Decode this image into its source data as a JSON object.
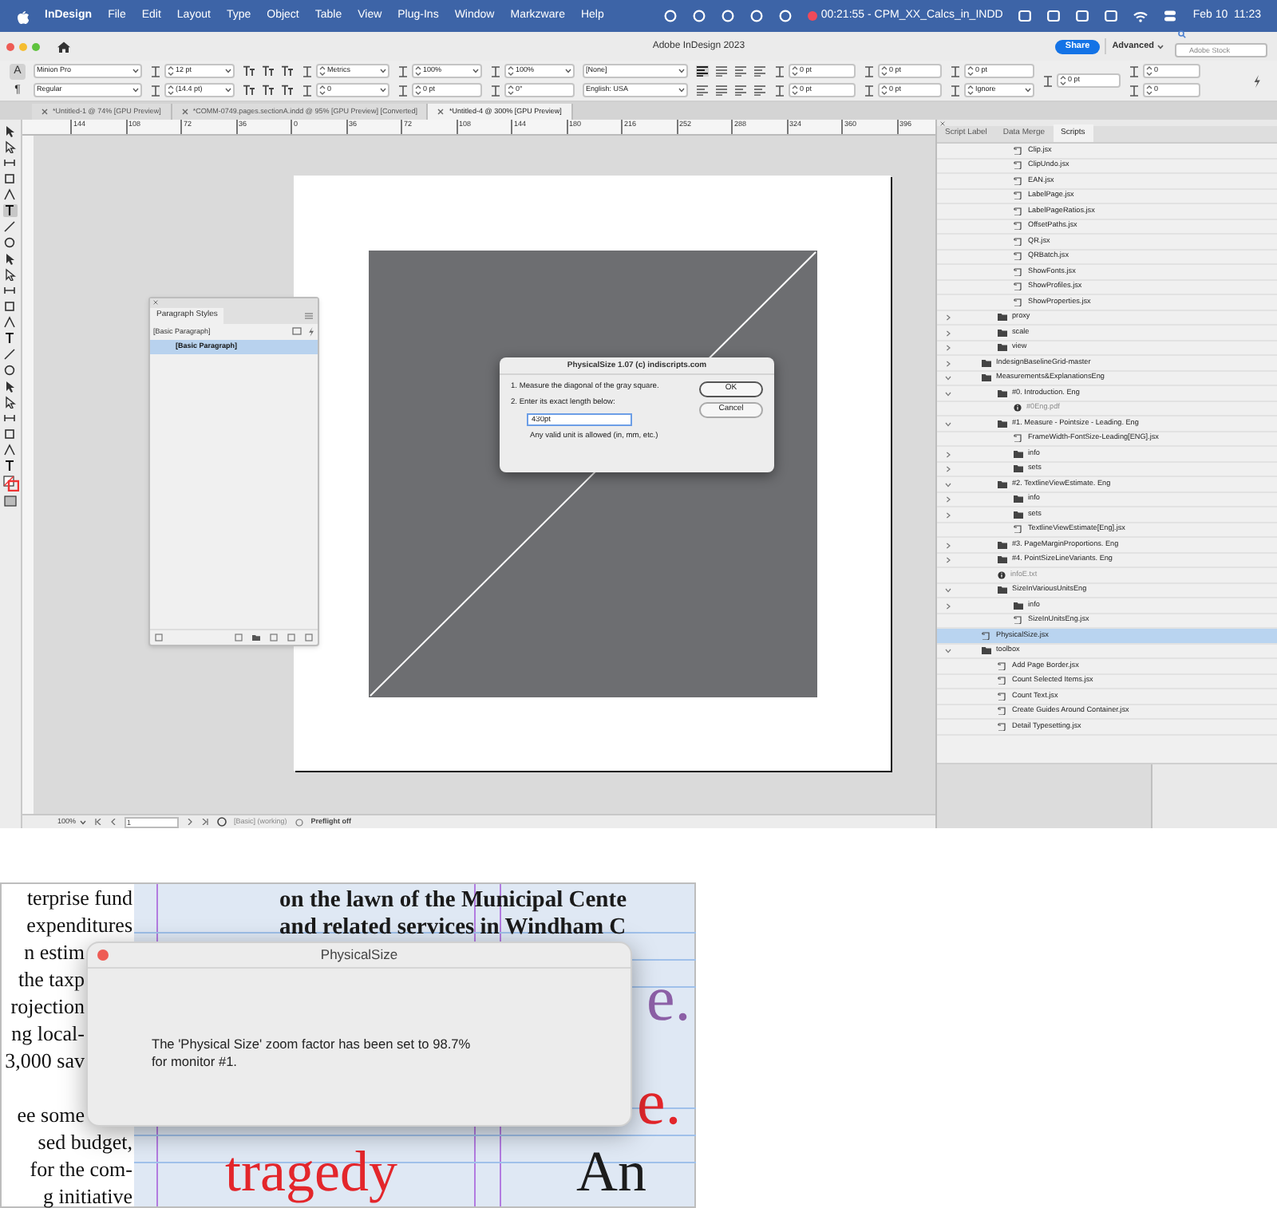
{
  "menu_bar": {
    "app": "InDesign",
    "items": [
      "File",
      "Edit",
      "Layout",
      "Type",
      "Object",
      "Table",
      "View",
      "Plug-Ins",
      "Window",
      "Markzware",
      "Help"
    ],
    "recording": "00:21:55 - CPM_XX_Calcs_in_INDD",
    "clock": "Feb 10  11:23"
  },
  "title_bar": {
    "title": "Adobe InDesign 2023",
    "share": "Share",
    "workspace": "Advanced",
    "search_placeholder": "Adobe Stock"
  },
  "control_panel": {
    "mode_buttons": [
      {
        "label": "A",
        "selected": true
      },
      {
        "label": "¶",
        "selected": false
      }
    ],
    "columns": [
      {
        "kind": "font",
        "fields": [
          {
            "value": "Minion Pro",
            "dropdown": true
          },
          {
            "value": "Regular",
            "dropdown": true
          }
        ]
      },
      {
        "kind": "spin",
        "fields": [
          {
            "value": "12 pt",
            "dropdown": true
          },
          {
            "value": "(14.4 pt)",
            "dropdown": true
          }
        ]
      },
      {
        "kind": "text_buttons"
      },
      {
        "kind": "spin",
        "fields": [
          {
            "value": "Metrics",
            "dropdown": true
          },
          {
            "value": "0",
            "dropdown": true
          }
        ]
      },
      {
        "kind": "spin",
        "fields": [
          {
            "value": "100%",
            "dropdown": true
          },
          {
            "value": "0 pt",
            "dropdown": false
          }
        ]
      },
      {
        "kind": "spin",
        "fields": [
          {
            "value": "100%",
            "dropdown": true
          },
          {
            "value": "0°",
            "dropdown": false
          }
        ]
      },
      {
        "kind": "select",
        "fields": [
          {
            "value": "[None]",
            "dropdown": true
          },
          {
            "value": "English: USA",
            "dropdown": true
          }
        ]
      },
      {
        "kind": "align_buttons"
      },
      {
        "kind": "spin",
        "fields": [
          {
            "value": "0 pt",
            "dropdown": false
          },
          {
            "value": "0 pt",
            "dropdown": false
          }
        ]
      },
      {
        "kind": "spin",
        "fields": [
          {
            "value": "0 pt",
            "dropdown": false
          },
          {
            "value": "0 pt",
            "dropdown": false
          }
        ]
      },
      {
        "kind": "spin",
        "fields": [
          {
            "value": "0 pt",
            "dropdown": false
          },
          {
            "value": "Ignore",
            "dropdown": true
          }
        ]
      },
      {
        "kind": "spin",
        "fields": [
          {
            "value": "0 pt",
            "dropdown": false
          }
        ]
      },
      {
        "kind": "spin",
        "fields": [
          {
            "value": "0",
            "dropdown": false
          },
          {
            "value": "0",
            "dropdown": false
          }
        ]
      }
    ]
  },
  "document_tabs": [
    {
      "label": "*Untitled-1 @ 74% [GPU Preview]",
      "selected": false
    },
    {
      "label": "*COMM-0749.pages.sectionA.indd @ 95% [GPU Preview] [Converted]",
      "selected": false
    },
    {
      "label": "*Untitled-4 @ 300% [GPU Preview]",
      "selected": true
    }
  ],
  "ruler": [
    "144",
    "108",
    "72",
    "36",
    "0",
    "36",
    "72",
    "108",
    "144",
    "180",
    "216",
    "252",
    "288",
    "324",
    "360",
    "396"
  ],
  "tools": [
    {
      "selected": false
    },
    {
      "selected": false
    },
    {
      "selected": false
    },
    {
      "selected": false
    },
    {
      "selected": false
    },
    {
      "selected": true
    },
    {
      "selected": false
    },
    {
      "selected": false
    },
    {
      "selected": false
    },
    {
      "selected": false
    },
    {
      "selected": false
    },
    {
      "selected": false
    },
    {
      "selected": false
    },
    {
      "selected": false
    },
    {
      "selected": false
    },
    {
      "selected": false
    },
    {
      "selected": false
    },
    {
      "selected": false
    },
    {
      "selected": false
    },
    {
      "selected": false
    },
    {
      "selected": false
    },
    {
      "selected": false
    }
  ],
  "paragraph_styles": {
    "tab": "Paragraph Styles",
    "current": "[Basic Paragraph]",
    "styles": [
      {
        "label": "[Basic Paragraph]",
        "selected": true
      }
    ]
  },
  "dialog": {
    "title": "PhysicalSize 1.07  (c) indiscripts.com",
    "steps": [
      "1. Measure the diagonal of the gray square.",
      "2. Enter its exact length below:"
    ],
    "input": "430pt",
    "hint": "Any valid unit is allowed (in, mm, etc.)",
    "buttons": [
      {
        "label": "OK",
        "default": true
      },
      {
        "label": "Cancel",
        "default": false
      }
    ]
  },
  "scripts_panel": {
    "tabs": [
      {
        "label": "Script Label",
        "selected": false
      },
      {
        "label": "Data Merge",
        "selected": false
      },
      {
        "label": "Scripts",
        "selected": true
      }
    ],
    "tree": [
      {
        "children": [
          {
            "children": [
              {
                "label": "Clip.jsx",
                "kind": "script",
                "selected": false
              },
              {
                "label": "ClipUndo.jsx",
                "kind": "script",
                "selected": false
              },
              {
                "label": "EAN.jsx",
                "kind": "script",
                "selected": false
              },
              {
                "label": "LabelPage.jsx",
                "kind": "script",
                "selected": false
              },
              {
                "label": "LabelPageRatios.jsx",
                "kind": "script",
                "selected": false
              },
              {
                "label": "OffsetPaths.jsx",
                "kind": "script",
                "selected": false
              },
              {
                "label": "QR.jsx",
                "kind": "script",
                "selected": false
              },
              {
                "label": "QRBatch.jsx",
                "kind": "script",
                "selected": false
              },
              {
                "label": "ShowFonts.jsx",
                "kind": "script",
                "selected": false
              },
              {
                "label": "ShowProfiles.jsx",
                "kind": "script",
                "selected": false
              },
              {
                "label": "ShowProperties.jsx",
                "kind": "script",
                "selected": false
              }
            ]
          },
          {
            "label": "proxy",
            "kind": "folder",
            "expanded": false,
            "selected": false
          },
          {
            "label": "scale",
            "kind": "folder",
            "expanded": false,
            "selected": false
          },
          {
            "label": "view",
            "kind": "folder",
            "expanded": false,
            "selected": false
          }
        ]
      },
      {
        "label": "IndesignBaselineGrid-master",
        "kind": "folder",
        "expanded": false,
        "selected": false
      },
      {
        "label": "Measurements&ExplanationsEng",
        "kind": "folder",
        "expanded": true,
        "selected": false,
        "children": [
          {
            "label": "#0. Introduction. Eng",
            "kind": "folder",
            "expanded": true,
            "selected": false,
            "children": [
              {
                "label": "#0Eng.pdf",
                "kind": "document",
                "selected": false
              }
            ]
          },
          {
            "label": "#1. Measure - Pointsize - Leading. Eng",
            "kind": "folder",
            "expanded": true,
            "selected": false,
            "children": [
              {
                "label": "FrameWidth-FontSize-Leading[ENG].jsx",
                "kind": "script",
                "selected": false
              },
              {
                "label": "info",
                "kind": "folder",
                "expanded": false,
                "selected": false
              },
              {
                "label": "sets",
                "kind": "folder",
                "expanded": false,
                "selected": false
              }
            ]
          },
          {
            "label": "#2. TextlineViewEstimate. Eng",
            "kind": "folder",
            "expanded": true,
            "selected": false,
            "children": [
              {
                "label": "info",
                "kind": "folder",
                "expanded": false,
                "selected": false
              },
              {
                "label": "sets",
                "kind": "folder",
                "expanded": false,
                "selected": false
              },
              {
                "label": "TextlineViewEstimate[Eng].jsx",
                "kind": "script",
                "selected": false
              }
            ]
          },
          {
            "label": "#3. PageMarginProportions. Eng",
            "kind": "folder",
            "expanded": false,
            "selected": false
          },
          {
            "label": "#4. PointSizeLineVariants. Eng",
            "kind": "folder",
            "expanded": false,
            "selected": false
          },
          {
            "label": "infoE.txt",
            "kind": "document",
            "selected": false
          },
          {
            "label": "SizeInVariousUnitsEng",
            "kind": "folder",
            "expanded": true,
            "selected": false,
            "children": [
              {
                "label": "info",
                "kind": "folder",
                "expanded": false,
                "selected": false
              },
              {
                "label": "SizeInUnitsEng.jsx",
                "kind": "script",
                "selected": false
              }
            ]
          }
        ]
      },
      {
        "label": "PhysicalSize.jsx",
        "kind": "script",
        "selected": true
      },
      {
        "label": "toolbox",
        "kind": "folder",
        "expanded": true,
        "selected": false,
        "children": [
          {
            "label": "Add Page Border.jsx",
            "kind": "script",
            "selected": false
          },
          {
            "label": "Count Selected Items.jsx",
            "kind": "script",
            "selected": false
          },
          {
            "label": "Count Text.jsx",
            "kind": "script",
            "selected": false
          },
          {
            "label": "Create Guides Around Container.jsx",
            "kind": "script",
            "selected": false
          },
          {
            "label": "Detail Typesetting.jsx",
            "kind": "script",
            "selected": false
          }
        ]
      }
    ]
  },
  "status_bar": {
    "zoom": "100%",
    "page": "1",
    "style": "[Basic] (working)",
    "preflight": "Preflight off"
  },
  "second_screenshot": {
    "left_column": [
      [
        "terprise fund",
        "expenditures",
        "n estim",
        "the taxp",
        "rojection",
        "ng local-",
        "3,000 sav"
      ],
      [
        "ee some",
        "sed budget,",
        "for the com-",
        "g initiative"
      ]
    ],
    "headline": [
      "on the lawn of the Municipal Cente",
      "and related services in Windham C"
    ],
    "display_words": [
      {
        "text": "e.",
        "color": "#8c5fa6"
      },
      {
        "text": "e.",
        "color": "#e3262b"
      },
      {
        "text": "tragedy",
        "color": "#e3262b"
      },
      {
        "text": "An",
        "color": "#1c1c1c"
      }
    ],
    "alert": {
      "title": "PhysicalSize",
      "message": "The 'Physical Size' zoom factor has been set to 98.7%\nfor monitor #1."
    }
  }
}
